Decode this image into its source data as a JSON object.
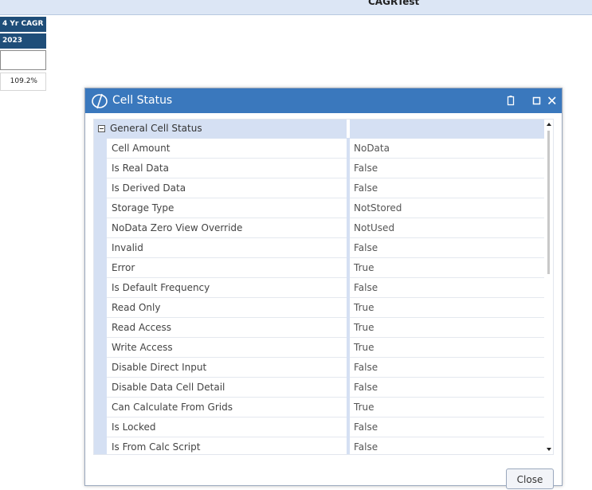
{
  "sheet": {
    "title": "CAGRTest",
    "header_row1": "4 Yr CAGR",
    "header_row2": "2023",
    "value": "109.2%"
  },
  "dialog": {
    "title": "Cell Status",
    "close_label": "Close",
    "category": "General Cell Status",
    "properties": [
      {
        "name": "Cell Amount",
        "value": "NoData"
      },
      {
        "name": "Is Real Data",
        "value": "False"
      },
      {
        "name": "Is Derived Data",
        "value": "False"
      },
      {
        "name": "Storage Type",
        "value": "NotStored"
      },
      {
        "name": "NoData Zero View Override",
        "value": "NotUsed"
      },
      {
        "name": "Invalid",
        "value": "False"
      },
      {
        "name": "Error",
        "value": "True"
      },
      {
        "name": "Is Default Frequency",
        "value": "False"
      },
      {
        "name": "Read Only",
        "value": "True"
      },
      {
        "name": "Read Access",
        "value": "True"
      },
      {
        "name": "Write Access",
        "value": "True"
      },
      {
        "name": "Disable Direct Input",
        "value": "False"
      },
      {
        "name": "Disable Data Cell Detail",
        "value": "False"
      },
      {
        "name": "Can Calculate From Grids",
        "value": "True"
      },
      {
        "name": "Is Locked",
        "value": "False"
      },
      {
        "name": "Is From Calc Script",
        "value": "False"
      }
    ]
  },
  "colors": {
    "title_bar": "#3a78bd",
    "header_cell": "#1f4e79",
    "category_bg": "#d5e0f3"
  }
}
